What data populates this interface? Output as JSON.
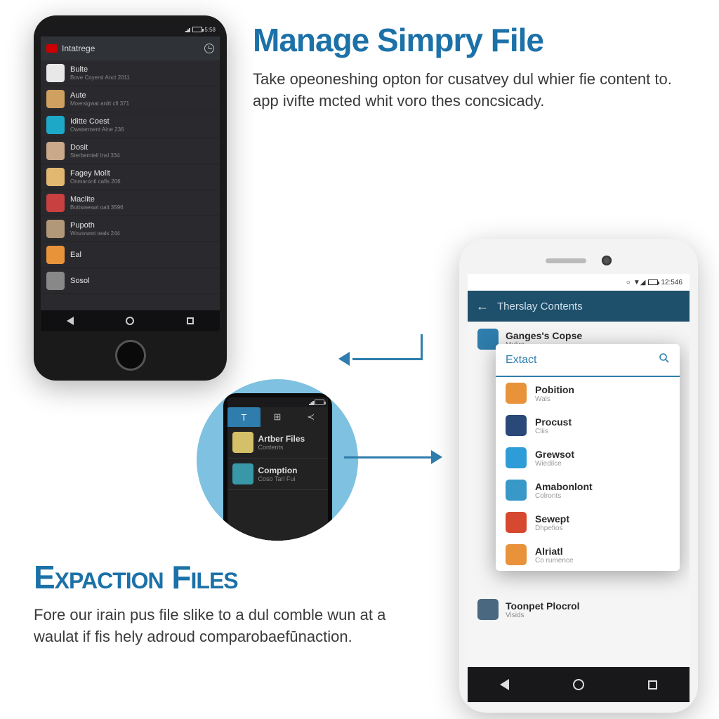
{
  "section1": {
    "heading": "Manage Simpry File",
    "body": "Take opeoneshing opton for cusatvey dul whier fie content to. app ivifte mcted whit voro thes concsicady."
  },
  "section2": {
    "heading": "Expaction Files",
    "body": "Fore our irain pus file slike to a dul comble wun at a waulat if fis hely adroud comparobaefūnaction."
  },
  "phone1": {
    "status_time": "5:58",
    "header_title": "Intatrege",
    "items": [
      {
        "title": "Bulte",
        "sub": "Bove Coyersl Anct 2011",
        "color": "#e8e8e8"
      },
      {
        "title": "Aute",
        "sub": "Moersigwat anitt cfi 371",
        "color": "#d0a060"
      },
      {
        "title": "Iditte Coest",
        "sub": "Owsterment Aine 236",
        "color": "#1ea8c8"
      },
      {
        "title": "Dosit",
        "sub": "Sterbemtell Insl 334",
        "color": "#caa98a"
      },
      {
        "title": "Fagey Mollt",
        "sub": "Onmarontl cafls 206",
        "color": "#e2b870"
      },
      {
        "title": "Maclite",
        "sub": "Bottsweswt oalt 3596",
        "color": "#c84040"
      },
      {
        "title": "Pupoth",
        "sub": "Wovsrwwt teals 244",
        "color": "#b09878"
      },
      {
        "title": "Eal",
        "sub": "",
        "color": "#e8923a"
      },
      {
        "title": "Sosol",
        "sub": "",
        "color": "#888888"
      }
    ]
  },
  "mini_phone": {
    "tab_active": "T",
    "rows": [
      {
        "title": "Artber Files",
        "sub": "Contents",
        "color": "#d4c068"
      },
      {
        "title": "Comption",
        "sub": "Coso Tarl Fui",
        "color": "#3898a8"
      }
    ]
  },
  "phone2": {
    "status_time": "12:546",
    "header_title": "Therslay Contents",
    "bg_top": {
      "title": "Ganges's Copse",
      "sub": "Mulira"
    },
    "bg_bottom": {
      "title": "Toonpet Plocrol",
      "sub": "Visids"
    },
    "popup": {
      "label": "Extact",
      "items": [
        {
          "title": "Pobition",
          "sub": "Wals",
          "color": "#e8923a"
        },
        {
          "title": "Procust",
          "sub": "Cliis",
          "color": "#2a4878"
        },
        {
          "title": "Grewsot",
          "sub": "Wiedilce",
          "color": "#2e9cd6"
        },
        {
          "title": "Amabonlont",
          "sub": "Colronts",
          "color": "#3898c8"
        },
        {
          "title": "Sewept",
          "sub": "Dhpefios",
          "color": "#d64830"
        },
        {
          "title": "Alriatl",
          "sub": "Co rumence",
          "color": "#e8923a"
        }
      ]
    }
  }
}
